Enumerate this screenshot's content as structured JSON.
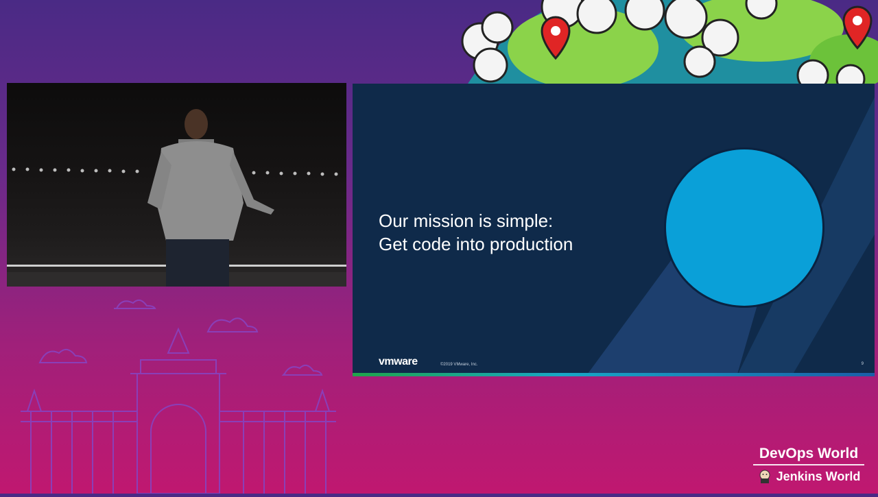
{
  "slide": {
    "title_line1": "Our mission is simple:",
    "title_line2": "Get code into production",
    "logo_text": "vmware",
    "copyright": "©2019 VMware, Inc.",
    "page_number": "9",
    "circle_color": "#0aa0d8",
    "background_color": "#0f2a4a"
  },
  "brand": {
    "line1": "DevOps World",
    "line2": "Jenkins World"
  },
  "icons": [
    "globe-illustration",
    "map-pin-icon",
    "jenkins-icon",
    "cloud-icon",
    "lisbon-arch-illustration"
  ]
}
